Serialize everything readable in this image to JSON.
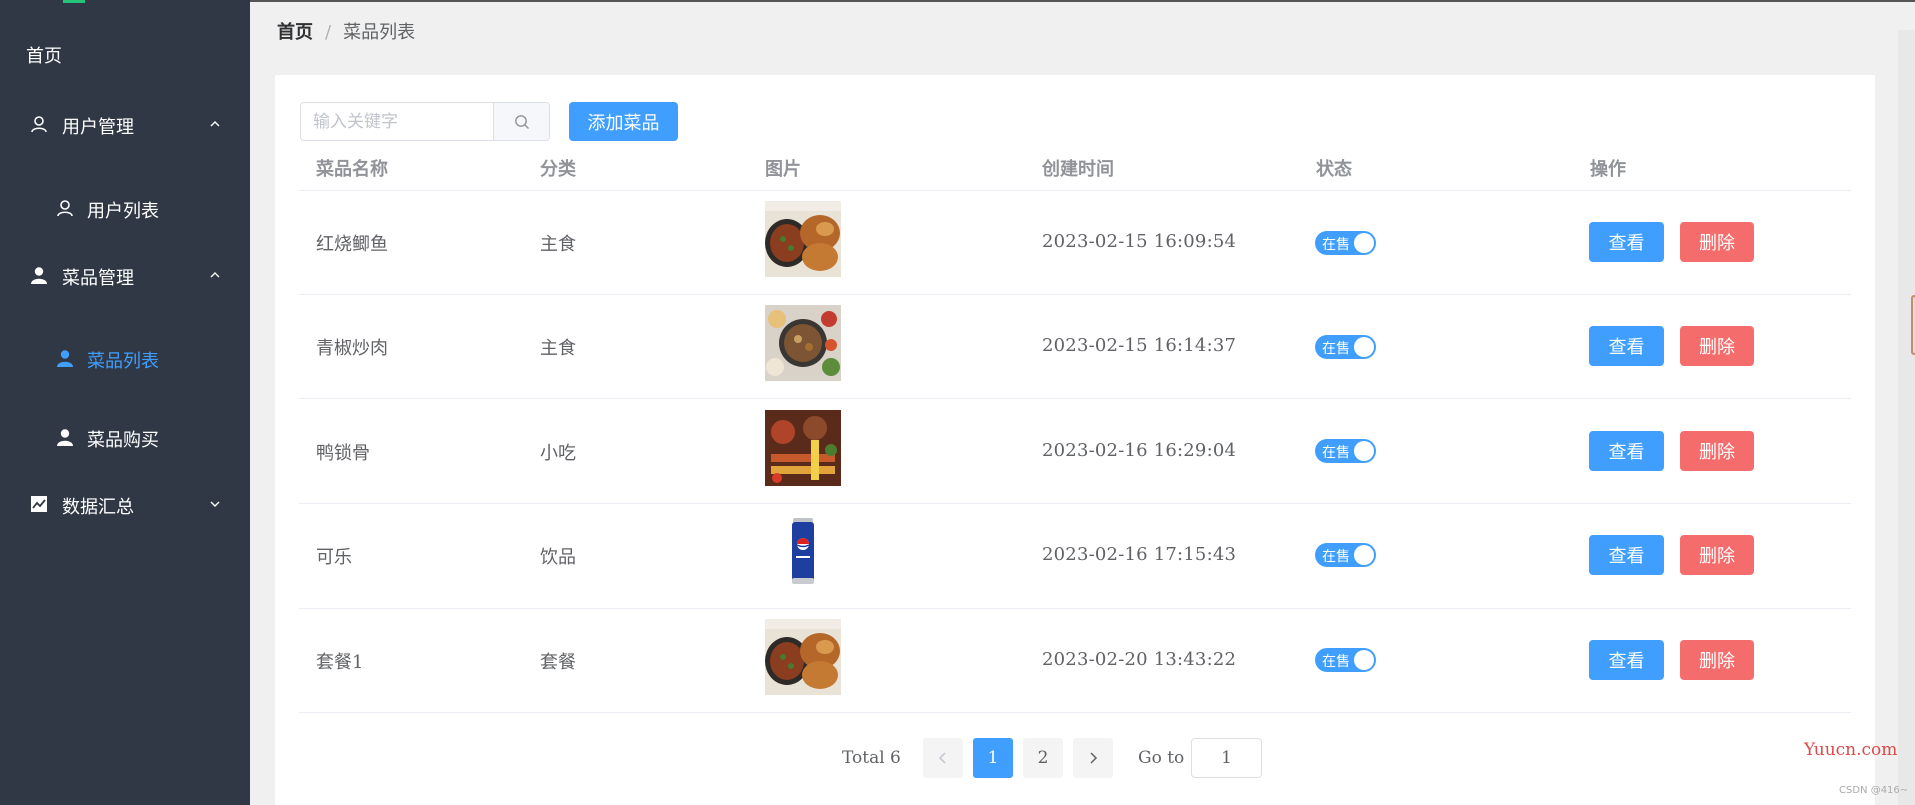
{
  "sidebar": {
    "home": "首页",
    "groups": [
      {
        "label": "用户管理",
        "icon": "user-outline-icon",
        "expanded": true,
        "items": [
          {
            "label": "用户列表",
            "icon": "user-outline-icon",
            "active": false
          }
        ]
      },
      {
        "label": "菜品管理",
        "icon": "user-filled-icon",
        "expanded": true,
        "items": [
          {
            "label": "菜品列表",
            "icon": "user-filled-icon",
            "active": true
          },
          {
            "label": "菜品购买",
            "icon": "user-filled-icon",
            "active": false
          }
        ]
      },
      {
        "label": "数据汇总",
        "icon": "chart-icon",
        "expanded": false,
        "items": []
      }
    ]
  },
  "breadcrumb": {
    "home": "首页",
    "separator": "/",
    "current": "菜品列表"
  },
  "toolbar": {
    "search_placeholder": "输入关键字",
    "search_value": "",
    "add_label": "添加菜品"
  },
  "table": {
    "headers": [
      "菜品名称",
      "分类",
      "图片",
      "创建时间",
      "状态",
      "操作"
    ],
    "rows": [
      {
        "name": "红烧鲫鱼",
        "category": "主食",
        "image": "fried-chicken-photo",
        "created": "2023-02-15 16:09:54",
        "status": "在售",
        "view": "查看",
        "delete": "删除"
      },
      {
        "name": "青椒炒肉",
        "category": "主食",
        "image": "stir-fry-platter-photo",
        "created": "2023-02-15 16:14:37",
        "status": "在售",
        "view": "查看",
        "delete": "删除"
      },
      {
        "name": "鸭锁骨",
        "category": "小吃",
        "image": "bbq-skewers-photo",
        "created": "2023-02-16 16:29:04",
        "status": "在售",
        "view": "查看",
        "delete": "删除"
      },
      {
        "name": "可乐",
        "category": "饮品",
        "image": "pepsi-can-photo",
        "created": "2023-02-16 17:15:43",
        "status": "在售",
        "view": "查看",
        "delete": "删除"
      },
      {
        "name": "套餐1",
        "category": "套餐",
        "image": "fried-chicken-photo",
        "created": "2023-02-20 13:43:22",
        "status": "在售",
        "view": "查看",
        "delete": "删除"
      }
    ]
  },
  "pagination": {
    "total": "Total 6",
    "pages": [
      "1",
      "2"
    ],
    "current": "1",
    "goto_label": "Go to",
    "goto_value": "1"
  },
  "watermark": {
    "site": "Yuucn.com",
    "credit": "CSDN @416~"
  },
  "colors": {
    "primary": "#409eff",
    "danger": "#f56c6c",
    "sidebar": "#2f3844"
  }
}
